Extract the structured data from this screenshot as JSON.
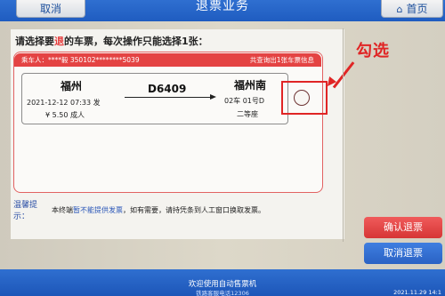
{
  "header": {
    "back_label": "取消",
    "title": "退票业务",
    "home_label": "首页"
  },
  "instruction": {
    "before": "请选择要",
    "highlight": "退",
    "after": "的车票，每次操作只能选择1张："
  },
  "card": {
    "passenger": "乘车人：****毅 350102********5039",
    "summary": "共查询出1张车票信息"
  },
  "ticket": {
    "from": "福州",
    "to": "福州南",
    "train_no": "D6409",
    "datetime": "2021-12-12 07:33 发",
    "price": "¥ 5.50 成人",
    "seat": "02车 01号D",
    "seat_class": "二等座",
    "selected": false
  },
  "annotation": {
    "label": "勾选",
    "color": "#e02525"
  },
  "notice": {
    "label": "温馨提示：",
    "text_before": "本终端",
    "text_link": "暂不能提供发票",
    "text_after": "，如有需要，请持凭条到人工窗口换取发票。"
  },
  "actions": {
    "confirm_label": "确认退票",
    "cancel_label": "取消退票"
  },
  "footer": {
    "welcome": "欢迎使用自动售票机",
    "sub": "铁路客服电话12306",
    "time": "2021.11.29  14:1"
  },
  "colors": {
    "header_blue": "#2f6fd0",
    "accent_red": "#e44343",
    "confirm_red": "#d63535",
    "cancel_blue": "#2a62c4"
  }
}
